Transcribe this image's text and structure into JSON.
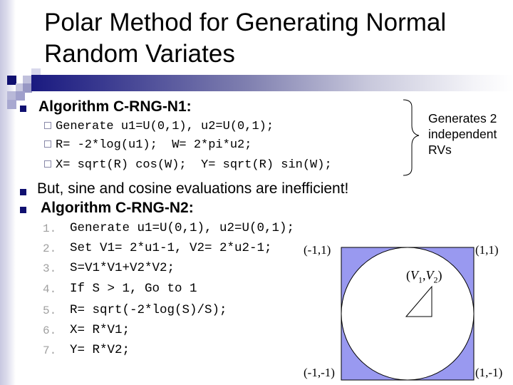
{
  "slide": {
    "title_lines": [
      "Polar Method for Generating Normal",
      "Random Variates"
    ],
    "colors": {
      "title_bar_start": "#1a1a80",
      "bullet": "#101070",
      "square_fill": "#9999f0",
      "sub_bullet_box": "#8888a8",
      "line_number": "#a0a0a0"
    }
  },
  "bullets": [
    {
      "label": "Algorithm C-RNG-N1:",
      "style": "bold",
      "sub_items": [
        "Generate u1=U(0,1), u2=U(0,1);",
        "R= -2*log(u1);  W= 2*pi*u2;",
        "X= sqrt(R) cos(W);  Y= sqrt(R) sin(W);"
      ]
    },
    {
      "label": "But, sine and cosine evaluations are inefficient!",
      "style": "normal"
    },
    {
      "label": " Algorithm C-RNG-N2:",
      "style": "bold",
      "steps": [
        {
          "num": "1.",
          "text": "Generate u1=U(0,1), u2=U(0,1);"
        },
        {
          "num": "2.",
          "text": "Set V1= 2*u1-1, V2= 2*u2-1;"
        },
        {
          "num": "3.",
          "text": "S=V1*V1+V2*V2;"
        },
        {
          "num": "4.",
          "text": "If S > 1, Go to 1"
        },
        {
          "num": "5.",
          "text": "R= sqrt(-2*log(S)/S);"
        },
        {
          "num": "6.",
          "text": "X= R*V1;"
        },
        {
          "num": "7.",
          "text": "Y= R*V2;"
        }
      ]
    }
  ],
  "brace_note": {
    "lines": [
      "Generates 2",
      "independent",
      "RVs"
    ]
  },
  "diagram": {
    "corner_labels": {
      "top_left": "(-1,1)",
      "top_right": "(1,1)",
      "bottom_left": "(-1,-1)",
      "bottom_right": "(1,-1)"
    },
    "point_label": {
      "v1": "V",
      "v1_sub": "1",
      "v2": "V",
      "v2_sub": "2"
    }
  }
}
